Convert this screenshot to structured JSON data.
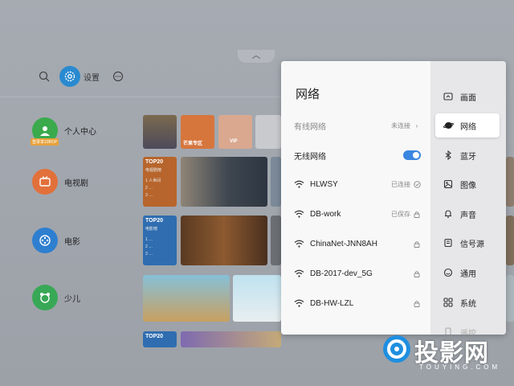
{
  "background": {
    "settings_label": "设置",
    "categories": [
      {
        "label": "个人中心",
        "badge": "登录享10BOP",
        "color": "#3aaa4d"
      },
      {
        "label": "电视剧",
        "color": "#e2703a"
      },
      {
        "label": "电影",
        "color": "#2f7fd0"
      },
      {
        "label": "少儿",
        "color": "#38a856"
      }
    ],
    "tiles": {
      "mango": "芒果专区",
      "vip": "VIP",
      "top20_tv": "TOP20",
      "top20_tv_sub": "电视剧榜",
      "top20_tv_items": [
        "1 人世间",
        "2 …",
        "3 …"
      ],
      "top20_movie": "TOP20",
      "top20_movie_sub": "电影榜",
      "top20_movie_items": [
        "1 …",
        "2 …",
        "3 …"
      ],
      "top20_bottom": "TOP20"
    }
  },
  "panel": {
    "title": "网络",
    "wired": {
      "label": "有线网络",
      "status": "未连接"
    },
    "wireless": {
      "label": "无线网络"
    },
    "networks": [
      {
        "ssid": "HLWSY",
        "status": "已连接",
        "tail": "check-icon"
      },
      {
        "ssid": "DB-work",
        "status": "已保存",
        "tail": "lock-icon"
      },
      {
        "ssid": "ChinaNet-JNN8AH",
        "status": "",
        "tail": "lock-icon"
      },
      {
        "ssid": "DB-2017-dev_5G",
        "status": "",
        "tail": "lock-icon"
      },
      {
        "ssid": "DB-HW-LZL",
        "status": "",
        "tail": "lock-icon"
      }
    ]
  },
  "menu": {
    "items": [
      {
        "label": "画面",
        "icon": "picture-icon"
      },
      {
        "label": "网络",
        "icon": "globe-icon",
        "active": true
      },
      {
        "label": "蓝牙",
        "icon": "bluetooth-icon"
      },
      {
        "label": "图像",
        "icon": "image-icon"
      },
      {
        "label": "声音",
        "icon": "bell-icon"
      },
      {
        "label": "信号源",
        "icon": "signal-source-icon"
      },
      {
        "label": "通用",
        "icon": "general-icon"
      },
      {
        "label": "系统",
        "icon": "system-icon"
      },
      {
        "label": "遥控",
        "icon": "remote-icon"
      }
    ]
  },
  "watermark": {
    "text": "投影网",
    "sub": "TOUYING.COM"
  },
  "colors": {
    "accent": "#3a86e0",
    "panel_bg": "#f8f8f8",
    "menu_bg": "#e7e7e9"
  }
}
